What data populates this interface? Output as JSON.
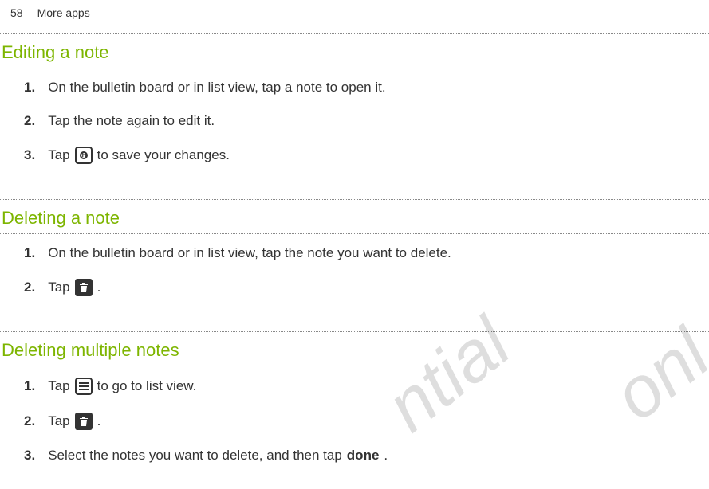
{
  "header": {
    "page_number": "58",
    "chapter": "More apps"
  },
  "sections": [
    {
      "heading": "Editing a note",
      "steps": [
        {
          "num": "1.",
          "text": "On the bulletin board or in list view, tap a note to open it."
        },
        {
          "num": "2.",
          "text": "Tap the note again to edit it."
        },
        {
          "num": "3.",
          "pre": "Tap",
          "icon": "save",
          "post": "to save your changes."
        }
      ]
    },
    {
      "heading": "Deleting a note",
      "steps": [
        {
          "num": "1.",
          "text": "On the bulletin board or in list view, tap the note you want to delete."
        },
        {
          "num": "2.",
          "pre": "Tap",
          "icon": "trash",
          "post": "."
        }
      ]
    },
    {
      "heading": "Deleting multiple notes",
      "steps": [
        {
          "num": "1.",
          "pre": "Tap",
          "icon": "list",
          "post": "to go to list view."
        },
        {
          "num": "2.",
          "pre": "Tap",
          "icon": "trash",
          "post": "."
        },
        {
          "num": "3.",
          "pre": "Select the notes you want to delete, and then tap",
          "bold": "done",
          "post": "."
        }
      ]
    }
  ],
  "watermarks": {
    "w1": "ntial",
    "w2": "onl"
  }
}
